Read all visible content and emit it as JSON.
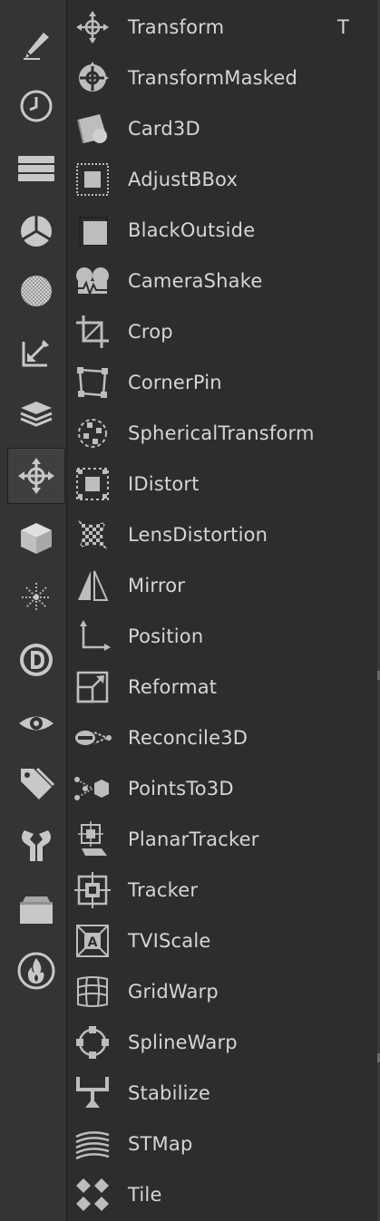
{
  "colors": {
    "panel_background": "#2d2d2d",
    "toolbar_background": "#343434",
    "icon_color": "#c8c8c8",
    "text_color": "#d6d6d6"
  },
  "toolbar": {
    "items": [
      {
        "icon": "pencil-icon"
      },
      {
        "icon": "clock-icon"
      },
      {
        "icon": "layers-stack-icon"
      },
      {
        "icon": "color-wheel-icon"
      },
      {
        "icon": "hatched-circle-icon"
      },
      {
        "icon": "eyedropper-arrow-icon"
      },
      {
        "icon": "merge-stack-icon"
      },
      {
        "icon": "transform-move-icon",
        "selected": true
      },
      {
        "icon": "cube-icon"
      },
      {
        "icon": "particle-burst-icon"
      },
      {
        "icon": "d-badge-icon"
      },
      {
        "icon": "eye-icon"
      },
      {
        "icon": "tag-icon"
      },
      {
        "icon": "wrench-icon"
      },
      {
        "icon": "toolset-box-icon"
      },
      {
        "icon": "flame-icon"
      }
    ]
  },
  "menu": {
    "items": [
      {
        "label": "Transform",
        "shortcut": "T",
        "icon": "transform-icon"
      },
      {
        "label": "TransformMasked",
        "icon": "transform-masked-icon"
      },
      {
        "label": "Card3D",
        "icon": "card3d-icon"
      },
      {
        "label": "AdjustBBox",
        "icon": "adjust-bbox-icon"
      },
      {
        "label": "BlackOutside",
        "icon": "black-outside-icon"
      },
      {
        "label": "CameraShake",
        "icon": "camera-shake-icon"
      },
      {
        "label": "Crop",
        "icon": "crop-icon"
      },
      {
        "label": "CornerPin",
        "icon": "corner-pin-icon"
      },
      {
        "label": "SphericalTransform",
        "icon": "spherical-transform-icon"
      },
      {
        "label": "IDistort",
        "icon": "idistort-icon"
      },
      {
        "label": "LensDistortion",
        "icon": "lens-distortion-icon"
      },
      {
        "label": "Mirror",
        "icon": "mirror-icon"
      },
      {
        "label": "Position",
        "icon": "position-icon"
      },
      {
        "label": "Reformat",
        "icon": "reformat-icon"
      },
      {
        "label": "Reconcile3D",
        "icon": "reconcile3d-icon"
      },
      {
        "label": "PointsTo3D",
        "icon": "points-to-3d-icon"
      },
      {
        "label": "PlanarTracker",
        "icon": "planar-tracker-icon"
      },
      {
        "label": "Tracker",
        "icon": "tracker-icon"
      },
      {
        "label": "TVIScale",
        "icon": "tviscale-icon"
      },
      {
        "label": "GridWarp",
        "icon": "gridwarp-icon"
      },
      {
        "label": "SplineWarp",
        "icon": "splinewarp-icon"
      },
      {
        "label": "Stabilize",
        "icon": "stabilize-icon"
      },
      {
        "label": "STMap",
        "icon": "stmap-icon"
      },
      {
        "label": "Tile",
        "icon": "tile-icon"
      }
    ]
  }
}
